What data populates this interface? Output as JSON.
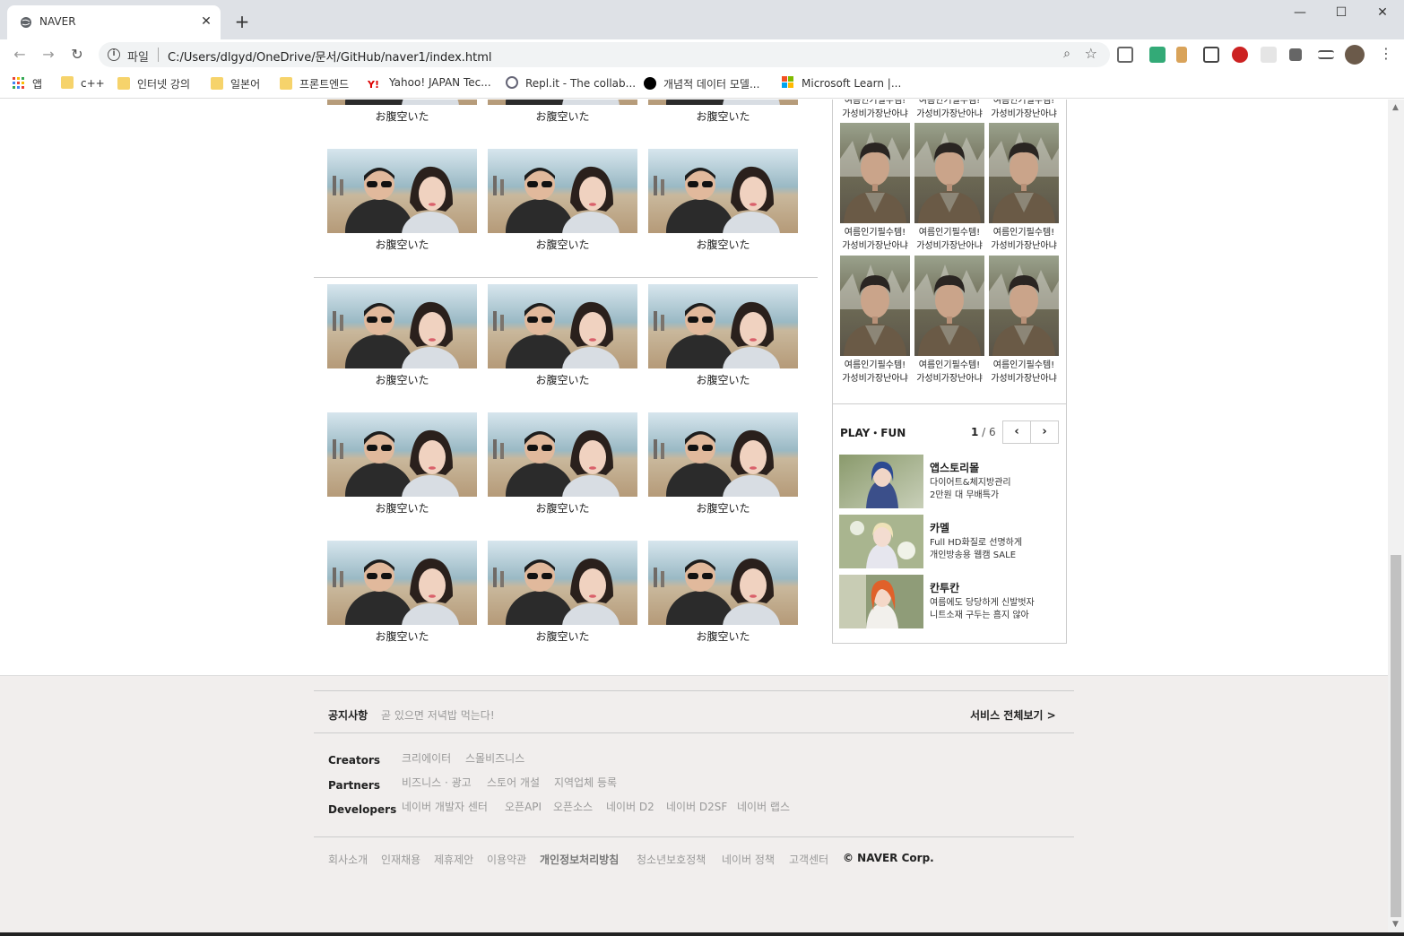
{
  "browser": {
    "tab_title": "NAVER",
    "close_glyph": "✕",
    "new_tab_glyph": "+",
    "url_scheme": "파일",
    "url": "C:/Users/dlgyd/OneDrive/문서/GitHub/naver1/index.html",
    "window_controls": [
      "—",
      "☐",
      "✕"
    ],
    "bookmarks": [
      {
        "label": "앱",
        "icon": "apps-grid-icon"
      },
      {
        "label": "c++",
        "icon": "folder-icon"
      },
      {
        "label": "인터넷 강의",
        "icon": "folder-icon"
      },
      {
        "label": "일본어",
        "icon": "folder-icon"
      },
      {
        "label": "프론트엔드",
        "icon": "folder-icon"
      },
      {
        "label": "Yahoo! JAPAN Tec...",
        "icon": "yahoo-icon"
      },
      {
        "label": "Repl.it - The collab...",
        "icon": "replit-icon"
      },
      {
        "label": "개념적 데이터 모델...",
        "icon": "black-circle-icon"
      },
      {
        "label": "Microsoft Learn |...",
        "icon": "microsoft-icon"
      }
    ]
  },
  "gallery": {
    "caption": "お腹空いた"
  },
  "sidebar": {
    "item_caption_line1": "여름인기필수템!",
    "item_caption_line2": "가성비가장난아냐",
    "playfun": {
      "title": "PLAY・FUN",
      "current_page": "1",
      "page_sep": " / ",
      "total_pages": "6",
      "prev_glyph": "‹",
      "next_glyph": "›",
      "items": [
        {
          "name": "앱스토리몰",
          "line1": "다이어트&체지방관리",
          "line2": "2만원 대 무배특가"
        },
        {
          "name": "카멜",
          "line1": "Full HD화질로 선명하게",
          "line2": "개인방송용 웹캠 SALE"
        },
        {
          "name": "칸투칸",
          "line1": "여름에도 당당하게 신발벗자",
          "line2": "니트소재 구두는 흠지 않아"
        }
      ]
    }
  },
  "footer": {
    "notice_title": "공지사항",
    "notice_text": "곧 있으면 저녁밥 먹는다!",
    "service_all": "서비스 전체보기 >",
    "groups": [
      {
        "label": "Creators",
        "links": [
          "크리에이터",
          "스몰비즈니스"
        ]
      },
      {
        "label": "Partners",
        "links": [
          "비즈니스 · 광고",
          "스토어 개설",
          "지역업체 등록"
        ]
      },
      {
        "label": "Developers",
        "links": [
          "네이버 개발자 센터",
          "오픈API",
          "오픈소스",
          "네이버 D2",
          "네이버 D2SF",
          "네이버 랩스"
        ]
      }
    ],
    "bottom_links": [
      "회사소개",
      "인재채용",
      "제휴제안",
      "이용약관",
      "개인정보처리방침",
      "청소년보호정책",
      "네이버 정책",
      "고객센터"
    ],
    "copyright": "© NAVER Corp."
  }
}
